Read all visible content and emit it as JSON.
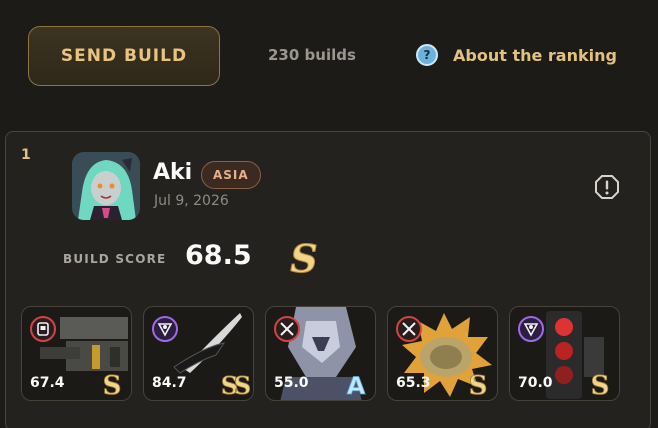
{
  "topbar": {
    "send_label": "SEND BUILD",
    "count_text": "230 builds",
    "about_label": "About the ranking",
    "about_icon": "question-circle-icon"
  },
  "entry": {
    "rank": "1",
    "name": "Aki",
    "region": "ASIA",
    "date": "Jul 9, 2026",
    "score_label": "BUILD SCORE",
    "score": "68.5",
    "score_grade": "S",
    "report_icon": "alert-circle-icon",
    "pieces": [
      {
        "value": "67.4",
        "grade": "S",
        "set_icon": "hacker-set-icon"
      },
      {
        "value": "84.7",
        "grade": "SS",
        "set_icon": "swing-jazz-set-icon"
      },
      {
        "value": "55.0",
        "grade": "A",
        "set_icon": "crossed-swords-set-icon"
      },
      {
        "value": "65.3",
        "grade": "S",
        "set_icon": "crossed-swords-set-icon"
      },
      {
        "value": "70.0",
        "grade": "S",
        "set_icon": "swing-jazz-set-icon"
      }
    ]
  },
  "colors": {
    "accent_gold": "#e3c27f",
    "region_tag": "#e6b08a",
    "grade_gold": "#f0d58a",
    "grade_a_blue": "#bfe8ff"
  }
}
